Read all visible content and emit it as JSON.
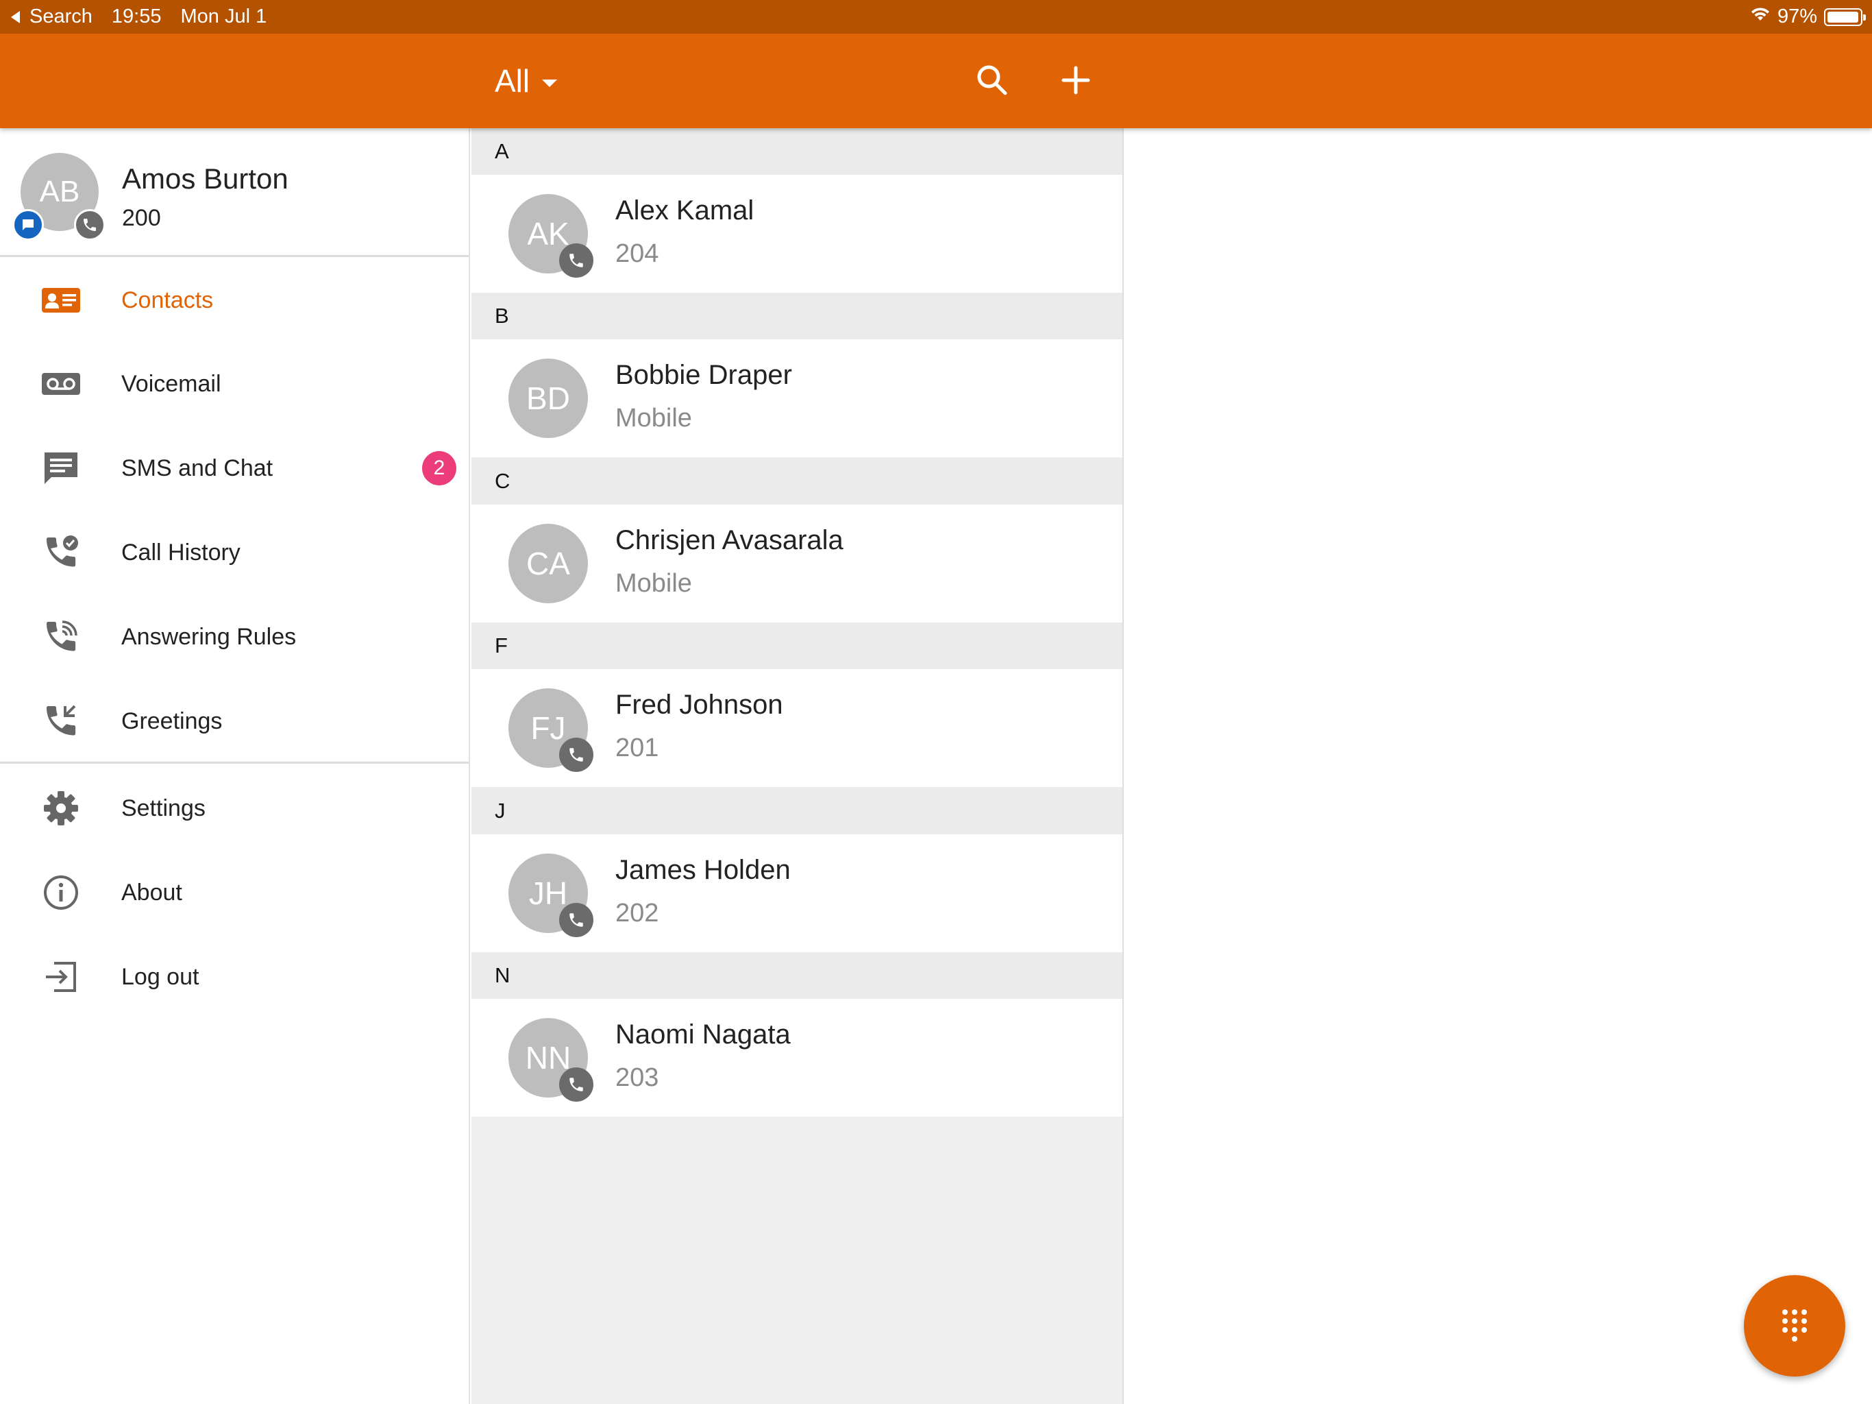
{
  "status_bar": {
    "back_label": "Search",
    "time": "19:55",
    "date": "Mon Jul 1",
    "battery": "97%",
    "battery_level": 0.97
  },
  "toolbar": {
    "filter_label": "All",
    "search_icon": "search-icon",
    "add_icon": "plus-icon"
  },
  "profile": {
    "initials": "AB",
    "name": "Amos Burton",
    "extension": "200"
  },
  "nav": {
    "items": [
      {
        "label": "Contacts",
        "icon": "contact-card-icon",
        "active": true
      },
      {
        "label": "Voicemail",
        "icon": "voicemail-icon"
      },
      {
        "label": "SMS and Chat",
        "icon": "chat-icon",
        "badge": "2"
      },
      {
        "label": "Call History",
        "icon": "call-history-icon"
      },
      {
        "label": "Answering Rules",
        "icon": "answering-rules-icon"
      },
      {
        "label": "Greetings",
        "icon": "greetings-icon"
      }
    ],
    "secondary": [
      {
        "label": "Settings",
        "icon": "gear-icon"
      },
      {
        "label": "About",
        "icon": "info-icon"
      },
      {
        "label": "Log out",
        "icon": "logout-icon"
      }
    ]
  },
  "contacts": {
    "sections": [
      {
        "letter": "A",
        "contacts": [
          {
            "initials": "AK",
            "name": "Alex Kamal",
            "sub": "204",
            "phone_badge": true
          }
        ]
      },
      {
        "letter": "B",
        "contacts": [
          {
            "initials": "BD",
            "name": "Bobbie Draper",
            "sub": "Mobile",
            "phone_badge": false
          }
        ]
      },
      {
        "letter": "C",
        "contacts": [
          {
            "initials": "CA",
            "name": "Chrisjen Avasarala",
            "sub": "Mobile",
            "phone_badge": false
          }
        ]
      },
      {
        "letter": "F",
        "contacts": [
          {
            "initials": "FJ",
            "name": "Fred Johnson",
            "sub": "201",
            "phone_badge": true
          }
        ]
      },
      {
        "letter": "J",
        "contacts": [
          {
            "initials": "JH",
            "name": "James Holden",
            "sub": "202",
            "phone_badge": true
          }
        ]
      },
      {
        "letter": "N",
        "contacts": [
          {
            "initials": "NN",
            "name": "Naomi Nagata",
            "sub": "203",
            "phone_badge": true
          }
        ]
      }
    ]
  },
  "fab": {
    "icon": "dialpad-icon"
  },
  "colors": {
    "accent": "#e06406",
    "status_bar": "#b45200",
    "badge": "#ec3d7a",
    "chat_badge": "#1565c0"
  }
}
